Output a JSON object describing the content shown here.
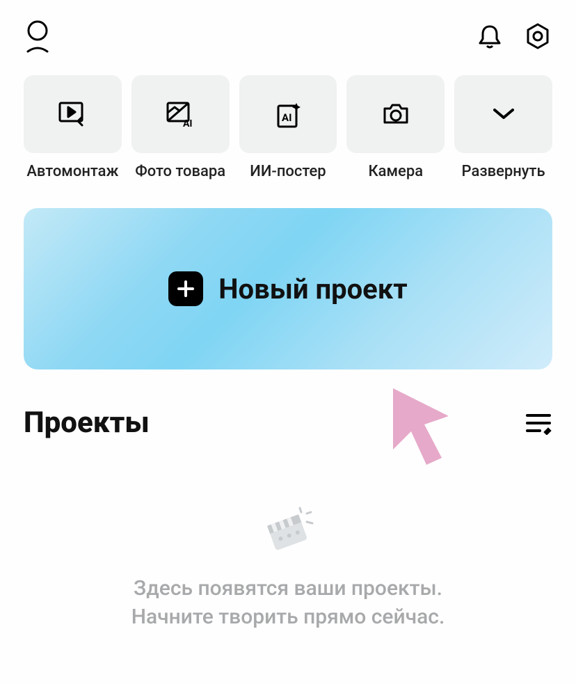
{
  "tools": [
    {
      "label": "Автомонтаж"
    },
    {
      "label": "Фото товара"
    },
    {
      "label": "ИИ-постер"
    },
    {
      "label": "Камера"
    },
    {
      "label": "Развернуть"
    }
  ],
  "new_project": {
    "label": "Новый проект"
  },
  "projects": {
    "title": "Проекты",
    "empty_line1": "Здесь появятся ваши проекты.",
    "empty_line2": "Начните творить прямо сейчас."
  }
}
